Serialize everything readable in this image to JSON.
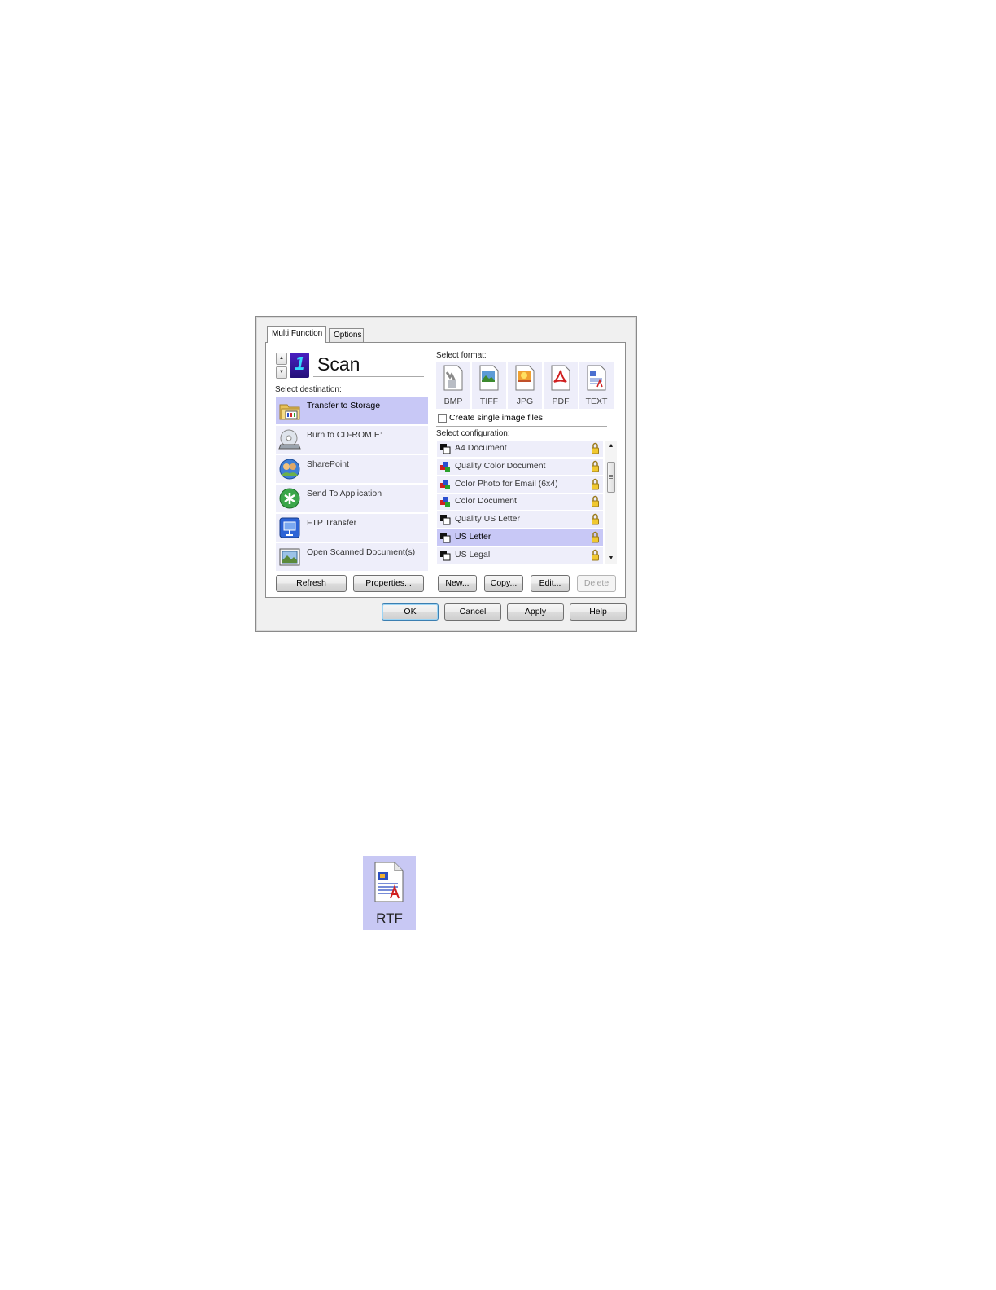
{
  "dialog": {
    "tabs": [
      "Multi Function",
      "Options"
    ],
    "function_number": "1",
    "function_name": "Scan",
    "select_destination_label": "Select destination:",
    "destinations": [
      {
        "label": "Transfer to Storage",
        "icon": "folder-storage-icon",
        "selected": true
      },
      {
        "label": "Burn to CD-ROM  E:",
        "icon": "cd-burn-icon",
        "selected": false
      },
      {
        "label": "SharePoint",
        "icon": "sharepoint-icon",
        "selected": false
      },
      {
        "label": "Send To Application",
        "icon": "send-to-application-icon",
        "selected": false
      },
      {
        "label": "FTP Transfer",
        "icon": "ftp-transfer-icon",
        "selected": false
      },
      {
        "label": "Open Scanned Document(s)",
        "icon": "open-document-icon",
        "selected": false
      }
    ],
    "select_format_label": "Select format:",
    "formats": [
      {
        "label": "BMP",
        "icon": "bmp-format-icon"
      },
      {
        "label": "TIFF",
        "icon": "tiff-format-icon"
      },
      {
        "label": "JPG",
        "icon": "jpg-format-icon"
      },
      {
        "label": "PDF",
        "icon": "pdf-format-icon"
      },
      {
        "label": "TEXT",
        "icon": "text-format-icon"
      }
    ],
    "create_single_image_files": "Create single image files",
    "create_single_image_checked": false,
    "select_configuration_label": "Select configuration:",
    "configurations": [
      {
        "label": "A4 Document",
        "type": "bw",
        "selected": false
      },
      {
        "label": "Quality Color Document",
        "type": "color",
        "selected": false
      },
      {
        "label": "Color Photo for Email (6x4)",
        "type": "color",
        "selected": false
      },
      {
        "label": "Color Document",
        "type": "color",
        "selected": false
      },
      {
        "label": "Quality US Letter",
        "type": "bw",
        "selected": false
      },
      {
        "label": "US Letter",
        "type": "bw",
        "selected": true
      },
      {
        "label": "US Legal",
        "type": "bw",
        "selected": false
      }
    ],
    "buttons": {
      "refresh": "Refresh",
      "properties": "Properties...",
      "new": "New...",
      "copy": "Copy...",
      "edit": "Edit...",
      "delete": "Delete",
      "ok": "OK",
      "cancel": "Cancel",
      "apply": "Apply",
      "help": "Help"
    }
  },
  "rtf_format": {
    "label": "RTF",
    "icon": "rtf-format-icon"
  },
  "colors": {
    "selection": "#c8c8f6",
    "list_bg": "#eeeefa",
    "dialog_bg": "#f0f0f0"
  }
}
